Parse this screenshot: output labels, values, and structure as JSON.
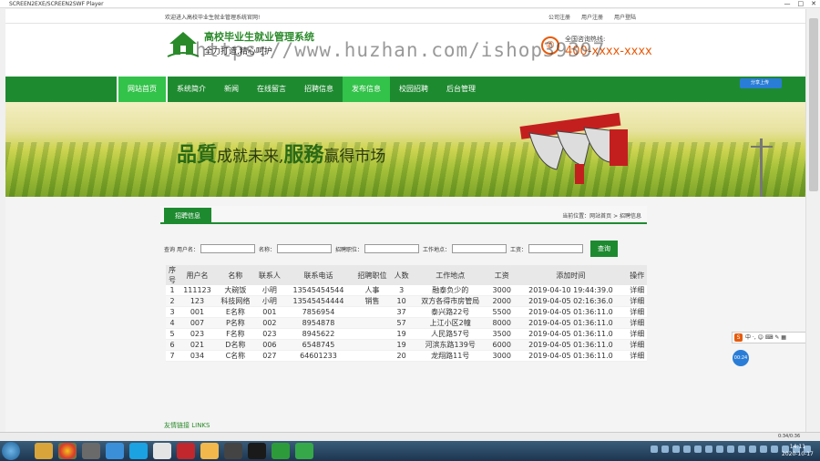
{
  "window": {
    "title": "SCREEN2EXE/SCREEN2SWF Player"
  },
  "topbar": {
    "welcome": "欢迎进入高校毕业生就业管理系统官网!",
    "links": [
      "公司注册",
      "用户注册",
      "用户登陆"
    ]
  },
  "header": {
    "title": "高校毕业生就业管理系统",
    "slogan": "全力打造,精心呵护",
    "hotline_label": "全国咨询热线:",
    "hotline_number": "400-xxxx-xxxx",
    "watermark": "https://www.huzhan.com/ishop39397"
  },
  "nav": {
    "items": [
      "网站首页",
      "系统简介",
      "新闻",
      "在线留言",
      "招聘信息",
      "发布信息",
      "校园招聘",
      "后台管理"
    ],
    "share_label": "分享上传"
  },
  "banner": {
    "slogan_a": "品質",
    "slogan_b": "成就未来,",
    "slogan_c": "服務",
    "slogan_d": "赢得市场"
  },
  "section": {
    "tab": "招聘信息",
    "breadcrumb": "当前位置：网站首页 > 招聘信息"
  },
  "search": {
    "title": "查询",
    "labels": [
      "用户名：",
      "名称：",
      "招聘职位：",
      "工作地点：",
      "工资："
    ],
    "button": "查询"
  },
  "table": {
    "headers": [
      "序号",
      "用户名",
      "名称",
      "联系人",
      "联系电话",
      "招聘职位",
      "人数",
      "工作地点",
      "工资",
      "添加时间",
      "操作"
    ],
    "rows": [
      [
        "1",
        "111123",
        "大碗饭",
        "小明",
        "13545454544",
        "人事",
        "3",
        "融泰负少的",
        "3000",
        "2019-04-10 19:44:39.0",
        "详细"
      ],
      [
        "2",
        "123",
        "科技网络",
        "小明",
        "13545454444",
        "销售",
        "10",
        "双方各得市房管局",
        "2000",
        "2019-04-05 02:16:36.0",
        "详细"
      ],
      [
        "3",
        "001",
        "E名称",
        "001",
        "7856954",
        "",
        "37",
        "泰兴路22号",
        "5500",
        "2019-04-05 01:36:11.0",
        "详细"
      ],
      [
        "4",
        "007",
        "P名称",
        "002",
        "8954878",
        "",
        "57",
        "上江小区2幢",
        "8000",
        "2019-04-05 01:36:11.0",
        "详细"
      ],
      [
        "5",
        "023",
        "F名称",
        "023",
        "8945622",
        "",
        "19",
        "人民路57号",
        "3500",
        "2019-04-05 01:36:11.0",
        "详细"
      ],
      [
        "6",
        "021",
        "D名称",
        "006",
        "6548745",
        "",
        "19",
        "河滨东路139号",
        "6000",
        "2019-04-05 01:36:11.0",
        "详细"
      ],
      [
        "7",
        "034",
        "C名称",
        "027",
        "64601233",
        "",
        "20",
        "龙翔路11号",
        "3000",
        "2019-04-05 01:36:11.0",
        "详细"
      ]
    ]
  },
  "footer": {
    "peek": "友情链接 LINKS"
  },
  "ime": {
    "label": "中 ·, ☺ ⌨ ✎ ▦"
  },
  "float_badge": "00:24",
  "status": {
    "time": "0:34/0:36"
  },
  "clock": {
    "time": "14:11",
    "date": "2020-10-17"
  },
  "colors": {
    "brand_green": "#1e8a30",
    "active_green": "#33c24a",
    "hotline_orange": "#e65b0c"
  }
}
